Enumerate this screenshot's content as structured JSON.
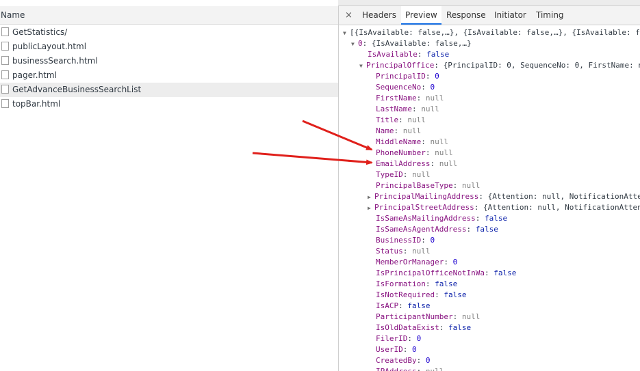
{
  "left_panel": {
    "header": "Name",
    "rows": [
      {
        "label": "GetStatistics/",
        "selected": false
      },
      {
        "label": "publicLayout.html",
        "selected": false
      },
      {
        "label": "businessSearch.html",
        "selected": false
      },
      {
        "label": "pager.html",
        "selected": false
      },
      {
        "label": "GetAdvanceBusinessSearchList",
        "selected": true
      },
      {
        "label": "topBar.html",
        "selected": false
      }
    ]
  },
  "tabs": {
    "close": "×",
    "items": [
      "Headers",
      "Preview",
      "Response",
      "Initiator",
      "Timing"
    ],
    "active": "Preview"
  },
  "preview": {
    "root": "[{IsAvailable: false,…}, {IsAvailable: false,…}, {IsAvailable: f",
    "item0_key": "0",
    "item0_value": "{IsAvailable: false,…}",
    "isavailable_key": "IsAvailable",
    "isavailable_value": "false",
    "principaloffice_key": "PrincipalOffice",
    "principaloffice_value": "{PrincipalID: 0, SequenceNo: 0, FirstName: n",
    "fields": [
      {
        "key": "PrincipalID",
        "value": "0",
        "type": "num",
        "expandable": false
      },
      {
        "key": "SequenceNo",
        "value": "0",
        "type": "num",
        "expandable": false
      },
      {
        "key": "FirstName",
        "value": "null",
        "type": "null",
        "expandable": false
      },
      {
        "key": "LastName",
        "value": "null",
        "type": "null",
        "expandable": false
      },
      {
        "key": "Title",
        "value": "null",
        "type": "null",
        "expandable": false
      },
      {
        "key": "Name",
        "value": "null",
        "type": "null",
        "expandable": false
      },
      {
        "key": "MiddleName",
        "value": "null",
        "type": "null",
        "expandable": false
      },
      {
        "key": "PhoneNumber",
        "value": "null",
        "type": "null",
        "expandable": false
      },
      {
        "key": "EmailAddress",
        "value": "null",
        "type": "null",
        "expandable": false
      },
      {
        "key": "TypeID",
        "value": "null",
        "type": "null",
        "expandable": false
      },
      {
        "key": "PrincipalBaseType",
        "value": "null",
        "type": "null",
        "expandable": false
      },
      {
        "key": "PrincipalMailingAddress",
        "value": "{Attention: null, NotificationAtte",
        "type": "obj",
        "expandable": true
      },
      {
        "key": "PrincipalStreetAddress",
        "value": "{Attention: null, NotificationAtten",
        "type": "obj",
        "expandable": true
      },
      {
        "key": "IsSameAsMailingAddress",
        "value": "false",
        "type": "bool",
        "expandable": false
      },
      {
        "key": "IsSameAsAgentAddress",
        "value": "false",
        "type": "bool",
        "expandable": false
      },
      {
        "key": "BusinessID",
        "value": "0",
        "type": "num",
        "expandable": false
      },
      {
        "key": "Status",
        "value": "null",
        "type": "null",
        "expandable": false
      },
      {
        "key": "MemberOrManager",
        "value": "0",
        "type": "num",
        "expandable": false
      },
      {
        "key": "IsPrincipalOfficeNotInWa",
        "value": "false",
        "type": "bool",
        "expandable": false
      },
      {
        "key": "IsFormation",
        "value": "false",
        "type": "bool",
        "expandable": false
      },
      {
        "key": "IsNotRequired",
        "value": "false",
        "type": "bool",
        "expandable": false
      },
      {
        "key": "IsACP",
        "value": "false",
        "type": "bool",
        "expandable": false
      },
      {
        "key": "ParticipantNumber",
        "value": "null",
        "type": "null",
        "expandable": false
      },
      {
        "key": "IsOldDataExist",
        "value": "false",
        "type": "bool",
        "expandable": false
      },
      {
        "key": "FilerID",
        "value": "0",
        "type": "num",
        "expandable": false
      },
      {
        "key": "UserID",
        "value": "0",
        "type": "num",
        "expandable": false
      },
      {
        "key": "CreatedBy",
        "value": "0",
        "type": "num",
        "expandable": false
      },
      {
        "key": "IPAddress",
        "value": "null",
        "type": "null",
        "expandable": false
      }
    ]
  },
  "annotation_color": "#e0201b"
}
